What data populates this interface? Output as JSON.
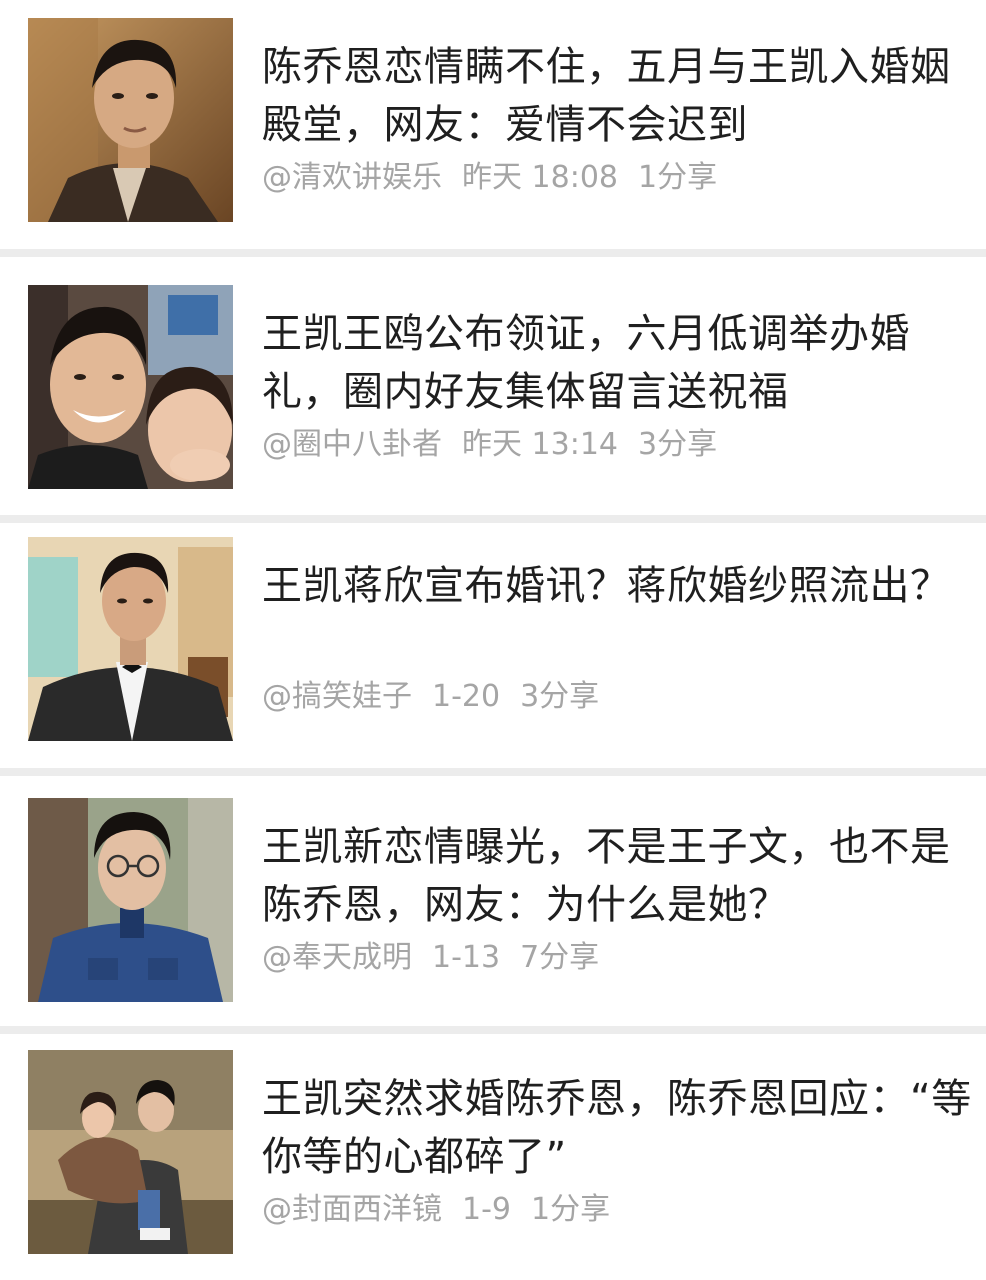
{
  "articles": [
    {
      "title": "陈乔恩恋情瞒不住，五月与王凯入婚姻殿堂，网友：爱情不会迟到",
      "source": "@清欢讲娱乐",
      "time": "昨天 18:08",
      "shares": "1分享",
      "thumbnail_icon": "photo-man-portrait"
    },
    {
      "title": "王凯王鸥公布领证，六月低调举办婚礼，圈内好友集体留言送祝福",
      "source": "@圈中八卦者",
      "time": "昨天 13:14",
      "shares": "3分享",
      "thumbnail_icon": "photo-couple-selfie"
    },
    {
      "title": "王凯蒋欣宣布婚讯？蒋欣婚纱照流出？",
      "source": "@搞笑娃子",
      "time": "1-20",
      "shares": "3分享",
      "thumbnail_icon": "photo-man-tuxedo"
    },
    {
      "title": "王凯新恋情曝光，不是王子文，也不是陈乔恩，网友：为什么是她？",
      "source": "@奉天成明",
      "time": "1-13",
      "shares": "7分享",
      "thumbnail_icon": "photo-man-glasses"
    },
    {
      "title": "王凯突然求婚陈乔恩，陈乔恩回应：“等你等的心都碎了”",
      "source": "@封面西洋镜",
      "time": "1-9",
      "shares": "1分享",
      "thumbnail_icon": "photo-couple-carry"
    }
  ],
  "colors": {
    "title": "#1f1f1f",
    "meta": "#a5a5a5",
    "background": "#ffffff",
    "divider": "#ececec"
  }
}
